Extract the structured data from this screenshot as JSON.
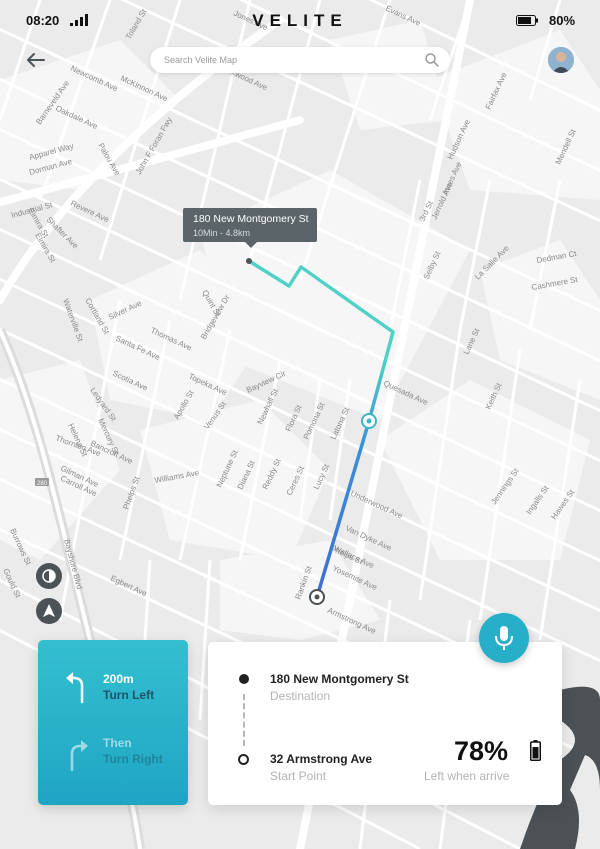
{
  "status_bar": {
    "time": "08:20",
    "brand": "VELITE",
    "battery_percent": "80%"
  },
  "search": {
    "placeholder": "Search Velite Map"
  },
  "map": {
    "tooltip": {
      "title": "180 New Montgomery St",
      "subtitle": "10Min - 4.8km"
    },
    "street_labels": [
      "Toland St",
      "Jones Ave",
      "Evans Ave",
      "Newcomb Ave",
      "McKinnon Ave",
      "Oakdale Ave",
      "Palou Ave",
      "Kirkwood Ave",
      "Barneveld Ave",
      "Dorman Ave",
      "Apparel Way",
      "Industrial St",
      "Revere Ave",
      "Shafter Ave",
      "Elmira St",
      "Quint St",
      "Silver Ave",
      "Thomas Ave",
      "Santa Fe Ave",
      "Bridgeview Dr",
      "Topeka Ave",
      "Apollo St",
      "Venus St",
      "Bayview Cir",
      "Newhall St",
      "Flora St",
      "Pomona St",
      "Latona St",
      "Lucy St",
      "Ceres St",
      "Reddy St",
      "Diana St",
      "Neptune St",
      "Bancroft Ave",
      "Williams Ave",
      "Armstrong Ave",
      "Yosemite Ave",
      "Wallace Ave",
      "Van Dyke Ave",
      "Underwood Ave",
      "3rd St",
      "Quesada Ave",
      "Keith St",
      "Lane St",
      "Hudson Ave",
      "Innes Ave",
      "Jerrold Ave",
      "Fairfax Ave",
      "Mendell St",
      "La Salle Ave",
      "Cashmere St",
      "Dedman Ct",
      "Jennings St",
      "Ingalls St",
      "Hawes St",
      "Gilman Ave",
      "Carroll Ave",
      "Egbert Ave",
      "Burrows St",
      "Gould St",
      "Bayshore Blvd",
      "Waterville St",
      "Mercury St",
      "Helena St",
      "Thornton Ave",
      "Phelps St",
      "Scotia Ave",
      "Ledyard St",
      "Cortland St",
      "Elmira St",
      "Rankin St",
      "Selby St",
      "Phelps St"
    ],
    "highway_label": "John F Foran Fwy",
    "highway_shield": "280"
  },
  "navigation": {
    "current_step": {
      "distance": "200m",
      "action": "Turn Left"
    },
    "next_step": {
      "distance": "Then",
      "action": "Turn Right"
    }
  },
  "trip": {
    "destination": {
      "name": "180 New Montgomery St",
      "label": "Destination"
    },
    "start": {
      "name": "32 Armstrong Ave",
      "label": "Start Point"
    },
    "battery_on_arrival": "78%",
    "battery_label": "Left when arrive"
  },
  "colors": {
    "route_start": "#3d6fd6",
    "route_end": "#4fd1c5",
    "accent": "#27aec9",
    "tooltip": "#5b6468"
  }
}
